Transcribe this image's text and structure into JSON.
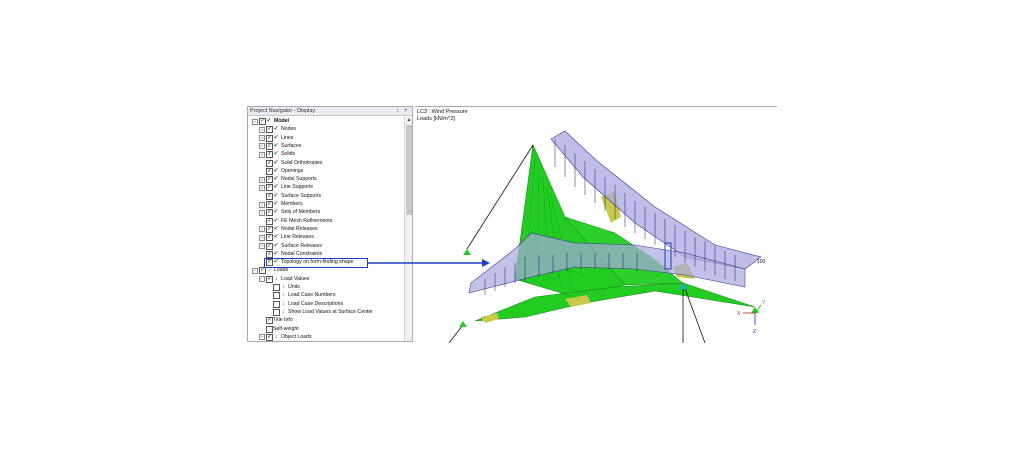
{
  "navigator": {
    "title": "Project Navigator - Display",
    "pin_label": "↓",
    "close_label": "×",
    "scroll_up": "▲",
    "items": [
      {
        "label": "Model",
        "level": 0,
        "expander": "−",
        "checkbox": true,
        "icon": "model-icon",
        "bold": true
      },
      {
        "label": "Nodes",
        "level": 1,
        "expander": "+",
        "checkbox": true,
        "icon": "check-icon"
      },
      {
        "label": "Lines",
        "level": 1,
        "expander": "+",
        "checkbox": true,
        "icon": "check-icon"
      },
      {
        "label": "Surfaces",
        "level": 1,
        "expander": "+",
        "checkbox": true,
        "icon": "check-icon"
      },
      {
        "label": "Solids",
        "level": 1,
        "expander": "+",
        "checkbox": true,
        "icon": "check-icon"
      },
      {
        "label": "Solid Orthotropies",
        "level": 1,
        "expander": "",
        "checkbox": true,
        "icon": "check-icon"
      },
      {
        "label": "Openings",
        "level": 1,
        "expander": "",
        "checkbox": true,
        "icon": "check-icon"
      },
      {
        "label": "Nodal Supports",
        "level": 1,
        "expander": "+",
        "checkbox": true,
        "icon": "check-icon"
      },
      {
        "label": "Line Supports",
        "level": 1,
        "expander": "+",
        "checkbox": true,
        "icon": "check-icon"
      },
      {
        "label": "Surface Supports",
        "level": 1,
        "expander": "",
        "checkbox": true,
        "icon": "check-icon"
      },
      {
        "label": "Members",
        "level": 1,
        "expander": "+",
        "checkbox": true,
        "icon": "check-icon"
      },
      {
        "label": "Sets of Members",
        "level": 1,
        "expander": "+",
        "checkbox": true,
        "icon": "check-icon"
      },
      {
        "label": "FE Mesh Refinements",
        "level": 1,
        "expander": "",
        "checkbox": true,
        "icon": "check-icon"
      },
      {
        "label": "Nodal Releases",
        "level": 1,
        "expander": "+",
        "checkbox": true,
        "icon": "check-icon"
      },
      {
        "label": "Line Releases",
        "level": 1,
        "expander": "+",
        "checkbox": true,
        "icon": "check-icon"
      },
      {
        "label": "Surface Releases",
        "level": 1,
        "expander": "+",
        "checkbox": true,
        "icon": "check-icon"
      },
      {
        "label": "Nodal Constraints",
        "level": 1,
        "expander": "",
        "checkbox": true,
        "icon": "check-icon"
      },
      {
        "label": "Topology on form-finding shape",
        "level": 1,
        "expander": "",
        "checkbox": true,
        "icon": "check-icon"
      },
      {
        "label": "Loads",
        "level": 0,
        "expander": "−",
        "checkbox": true,
        "icon": "load-icon",
        "bold": false
      },
      {
        "label": "Load Values",
        "level": 1,
        "expander": "−",
        "checkbox": true,
        "icon": "load-icon"
      },
      {
        "label": "Units",
        "level": 2,
        "expander": "",
        "checkbox": false,
        "icon": "load-icon"
      },
      {
        "label": "Load Case Numbers",
        "level": 2,
        "expander": "",
        "checkbox": false,
        "icon": "load-icon"
      },
      {
        "label": "Load Case Descriptions",
        "level": 2,
        "expander": "",
        "checkbox": false,
        "icon": "load-icon"
      },
      {
        "label": "Show Load Values at Surface Center",
        "level": 2,
        "expander": "",
        "checkbox": false,
        "icon": "load-icon"
      },
      {
        "label": "Title Info",
        "level": 1,
        "expander": "",
        "checkbox": true,
        "icon": ""
      },
      {
        "label": "Self-weight",
        "level": 1,
        "expander": "",
        "checkbox": false,
        "icon": ""
      },
      {
        "label": "Object Loads",
        "level": 1,
        "expander": "+",
        "checkbox": true,
        "icon": "load-icon"
      }
    ]
  },
  "viewport": {
    "load_case": "LC3 : Wind Pressure",
    "loads_unit": "Loads [kN/m^2]",
    "load_value": "100",
    "axis_x": "X",
    "axis_y": "Y",
    "axis_z": "Z"
  },
  "colors": {
    "membrane_green": "#22cc22",
    "membrane_yellow": "#c8c84a",
    "load_band": "#a8a8e0",
    "load_arrow": "#1a1a6a",
    "highlight": "#1a3fbf",
    "support_marker": "#22cc22"
  }
}
